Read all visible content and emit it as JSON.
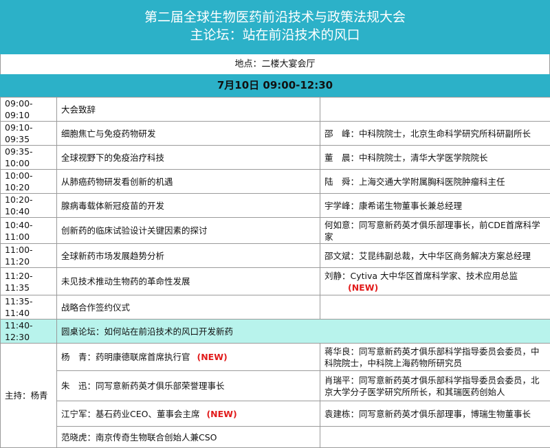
{
  "header": {
    "title": "第二届全球生物医药前沿技术与政策法规大会",
    "subtitle": "主论坛：站在前沿技术的风口",
    "location": "地点：二楼大宴会厅",
    "date": "7月10日  09:00-12:30"
  },
  "agenda": [
    {
      "time": "09:00-09:10",
      "topic": "大会致辞",
      "speaker": "",
      "new": false
    },
    {
      "time": "09:10-09:35",
      "topic": "细胞焦亡与免疫药物研发",
      "speaker": "邵　峰：中科院院士，北京生命科学研究所科研副所长",
      "new": false
    },
    {
      "time": "09:35-10:00",
      "topic": "全球视野下的免疫治疗科技",
      "speaker": "董　晨：中科院院士，清华大学医学院院长",
      "new": false
    },
    {
      "time": "10:00-10:20",
      "topic": "从肺癌药物研发看创新的机遇",
      "speaker": "陆　舜：上海交通大学附属胸科医院肿瘤科主任",
      "new": false
    },
    {
      "time": "10:20-10:40",
      "topic": "腺病毒载体新冠疫苗的开发",
      "speaker": "宇学峰：康希诺生物董事长兼总经理",
      "new": false
    },
    {
      "time": "10:40-11:00",
      "topic": "创新药的临床试验设计关键因素的探讨",
      "speaker": "何如意：同写意新药英才俱乐部理事长，前CDE首席科学家",
      "new": false
    },
    {
      "time": "11:00-11:20",
      "topic": "全球新药市场发展趋势分析",
      "speaker": "邵文斌：艾昆纬副总裁，大中华区商务解决方案总经理",
      "new": false
    },
    {
      "time": "11:20-11:35",
      "topic": "未见技术推动生物药的革命性发展",
      "speaker": "刘静：Cytiva 大中华区首席科学家、技术应用总监",
      "new": true
    },
    {
      "time": "11:35-11:40",
      "topic": "战略合作签约仪式",
      "speaker": "",
      "new": false
    }
  ],
  "roundtable": {
    "time": "11:40-12:30",
    "title": "圆桌论坛：如何站在前沿技术的风口开发新药",
    "host": "主持：杨青",
    "panelists_left": [
      {
        "text": "杨　青：药明康德联席首席执行官",
        "new": true
      },
      {
        "text": "朱　迅：同写意新药英才俱乐部荣誉理事长",
        "new": false
      },
      {
        "text": "江宁军：基石药业CEO、董事会主席",
        "new": true
      },
      {
        "text": "范晓虎：南京传奇生物联合创始人兼CSO",
        "new": false
      }
    ],
    "panelists_right": [
      {
        "text": "蒋华良：同写意新药英才俱乐部科学指导委员会委员，中科院院士，中科院上海药物所研究员"
      },
      {
        "text": "肖瑞平：同写意新药英才俱乐部科学指导委员会委员，北京大学分子医学研究所所长，和其瑞医药创始人"
      },
      {
        "text": "袁建栋：同写意新药英才俱乐部理事，博瑞生物董事长"
      }
    ]
  },
  "new_tag": "(NEW)",
  "colors": {
    "banner": "#2cb1c8",
    "highlight_row": "#b8f3ec",
    "new_tag": "#e11b1b"
  }
}
